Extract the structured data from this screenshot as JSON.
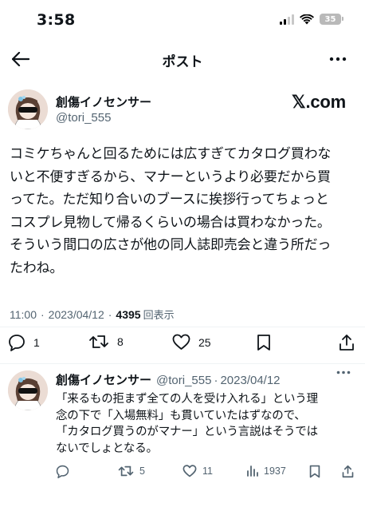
{
  "status_bar": {
    "time": "3:58",
    "battery": "35",
    "icons": [
      "cellular-signal-icon",
      "wifi-icon",
      "battery-icon"
    ]
  },
  "header": {
    "title": "ポスト",
    "back_icon": "arrow-left-icon",
    "more_icon": "more-horizontal-icon"
  },
  "tweet": {
    "author": {
      "display_name": "創傷イノセンサー",
      "handle": "@tori_555"
    },
    "source_badge": "𝕏.com",
    "lines": [
      "コミケちゃんと回るためには広すぎてカタログ買わな",
      "いと不便すぎるから、マナーというより必要だから買",
      "ってた。ただ知り合いのブースに挨拶行ってちょっと",
      "コスプレ見物して帰るくらいの場合は買わなかった。",
      "そういう間口の広さが他の同人誌即売会と違う所だっ",
      "たわね。"
    ],
    "time": "11:00",
    "date": "2023/04/12",
    "separator": "·",
    "views_count": "4395",
    "views_label": "回表示",
    "actions": {
      "reply_count": "1",
      "retweet_count": "8",
      "like_count": "25"
    }
  },
  "reply": {
    "display_name": "創傷イノセンサー",
    "handle": "@tori_555",
    "separator": "·",
    "date": "2023/04/12",
    "lines": [
      "「来るもの拒まず全ての人を受け入れる」という理",
      "念の下で「入場無料」も貫いていたはずなので、",
      "「カタログ買うのがマナー」という言説はそうでは",
      "ないでしょとなる。"
    ],
    "actions": {
      "reply_count": "",
      "retweet_count": "5",
      "like_count": "11",
      "views_count": "1937"
    }
  },
  "colors": {
    "text": "#0f1419",
    "secondary": "#536471",
    "divider": "#eff3f4"
  }
}
